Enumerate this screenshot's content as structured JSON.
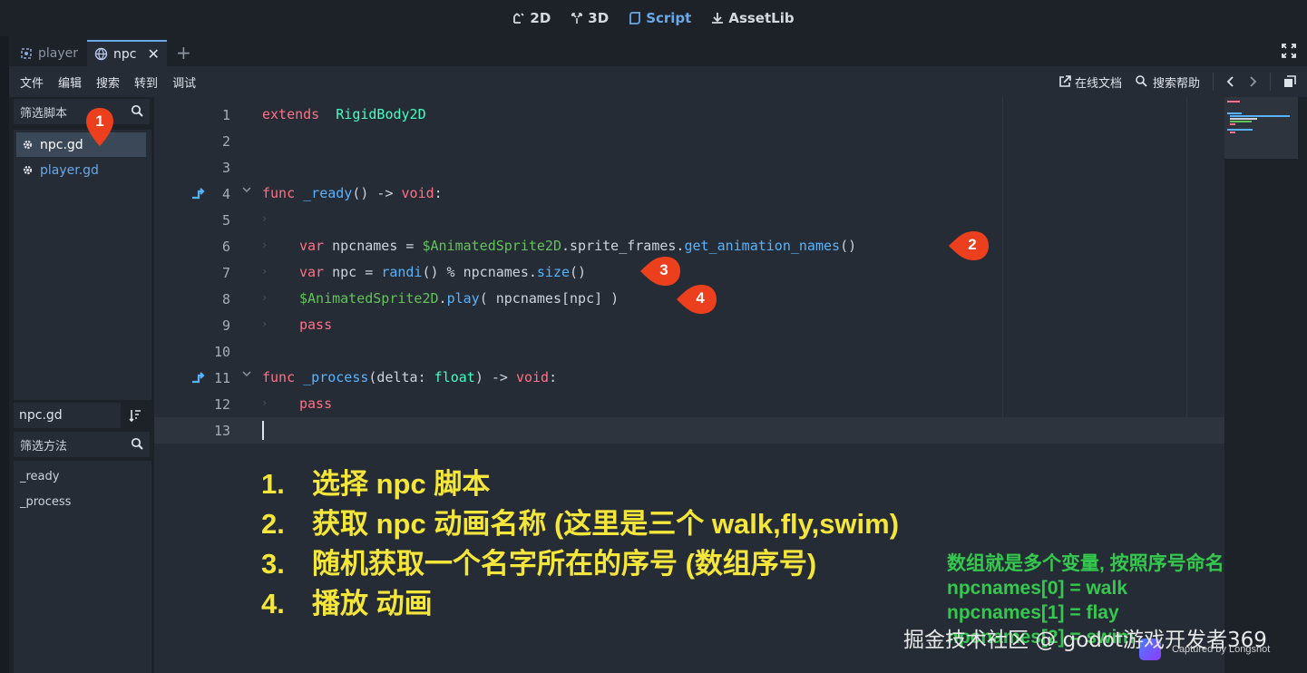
{
  "topbar": {
    "modes": [
      {
        "label": "2D",
        "icon": "2d-icon"
      },
      {
        "label": "3D",
        "icon": "3d-icon"
      },
      {
        "label": "Script",
        "icon": "script-icon",
        "active": true
      },
      {
        "label": "AssetLib",
        "icon": "assetlib-icon"
      }
    ]
  },
  "tabs": [
    {
      "label": "player",
      "icon": "node2d-icon"
    },
    {
      "label": "npc",
      "icon": "globe-icon",
      "active": true,
      "close": "✕"
    }
  ],
  "menubar": {
    "items": [
      "文件",
      "编辑",
      "搜索",
      "转到",
      "调试"
    ],
    "online_docs": "在线文档",
    "search_help": "搜索帮助"
  },
  "left_panel": {
    "script_filter_placeholder": "筛选脚本",
    "scripts": [
      {
        "name": "npc.gd",
        "selected": true
      },
      {
        "name": "player.gd",
        "selected": false
      }
    ],
    "current_file": "npc.gd",
    "method_filter_placeholder": "筛选方法",
    "methods": [
      "_ready",
      "_process"
    ]
  },
  "editor": {
    "lines": [
      {
        "n": "1",
        "code": [
          [
            "kw",
            "extends"
          ],
          [
            "",
            "  "
          ],
          [
            "cls",
            "RigidBody2D"
          ]
        ]
      },
      {
        "n": "2",
        "code": []
      },
      {
        "n": "3",
        "code": []
      },
      {
        "n": "4",
        "code": [
          [
            "kw",
            "func"
          ],
          [
            "",
            " "
          ],
          [
            "fn",
            "_ready"
          ],
          [
            "",
            "() -> "
          ],
          [
            "kw",
            "void"
          ],
          [
            "",
            ":"
          ]
        ],
        "fold": true,
        "override": true
      },
      {
        "n": "5",
        "code": [],
        "tab": true
      },
      {
        "n": "6",
        "code": [
          [
            "kw",
            "var"
          ],
          [
            "",
            " npcnames = "
          ],
          [
            "nodepath",
            "$AnimatedSprite2D"
          ],
          [
            "",
            ".sprite_frames."
          ],
          [
            "fn",
            "get_animation_names"
          ],
          [
            "",
            "()"
          ]
        ],
        "tab": true
      },
      {
        "n": "7",
        "code": [
          [
            "kw",
            "var"
          ],
          [
            "",
            " npc = "
          ],
          [
            "fn",
            "randi"
          ],
          [
            "",
            "() % npcnames."
          ],
          [
            "fn",
            "size"
          ],
          [
            "",
            "()"
          ]
        ],
        "tab": true
      },
      {
        "n": "8",
        "code": [
          [
            "nodepath",
            "$AnimatedSprite2D"
          ],
          [
            "",
            "."
          ],
          [
            "fn",
            "play"
          ],
          [
            "",
            "( npcnames[npc] )"
          ]
        ],
        "tab": true
      },
      {
        "n": "9",
        "code": [
          [
            "kw",
            "pass"
          ]
        ],
        "tab": true
      },
      {
        "n": "10",
        "code": []
      },
      {
        "n": "11",
        "code": [
          [
            "kw",
            "func"
          ],
          [
            "",
            " "
          ],
          [
            "fn",
            "_process"
          ],
          [
            "",
            "(delta: "
          ],
          [
            "cls",
            "float"
          ],
          [
            "",
            ") -> "
          ],
          [
            "kw",
            "void"
          ],
          [
            "",
            ":"
          ]
        ],
        "fold": true,
        "override": true
      },
      {
        "n": "12",
        "code": [
          [
            "kw",
            "pass"
          ]
        ],
        "tab": true
      },
      {
        "n": "13",
        "code": [],
        "current": true
      }
    ]
  },
  "annotations": {
    "pins": [
      "1",
      "2",
      "3",
      "4"
    ],
    "notes": [
      {
        "num": "1.",
        "text": "选择 npc 脚本"
      },
      {
        "num": "2.",
        "text": "获取 npc 动画名称 (这里是三个 walk,fly,swim)"
      },
      {
        "num": "3.",
        "text": "随机获取一个名字所在的序号 (数组序号)"
      },
      {
        "num": "4.",
        "text": "播放 动画"
      }
    ],
    "green_notes": [
      "数组就是多个变量, 按照序号命名",
      "npcnames[0]  = walk",
      "npcnames[1]   = flay",
      "npcnames[2]  = swim"
    ],
    "watermark": "掘金技术社区 @ godot游戏开发者369",
    "capture_tag": "Captured by Longshot"
  },
  "colors": {
    "keyword": "#ff7085",
    "class": "#42ffc2",
    "function": "#57b3ff",
    "node_path": "#63c259",
    "accent": "#6aa8e8",
    "pin": "#ec3f1d",
    "note_yellow": "#f5e63a",
    "note_green": "#34c94e"
  }
}
